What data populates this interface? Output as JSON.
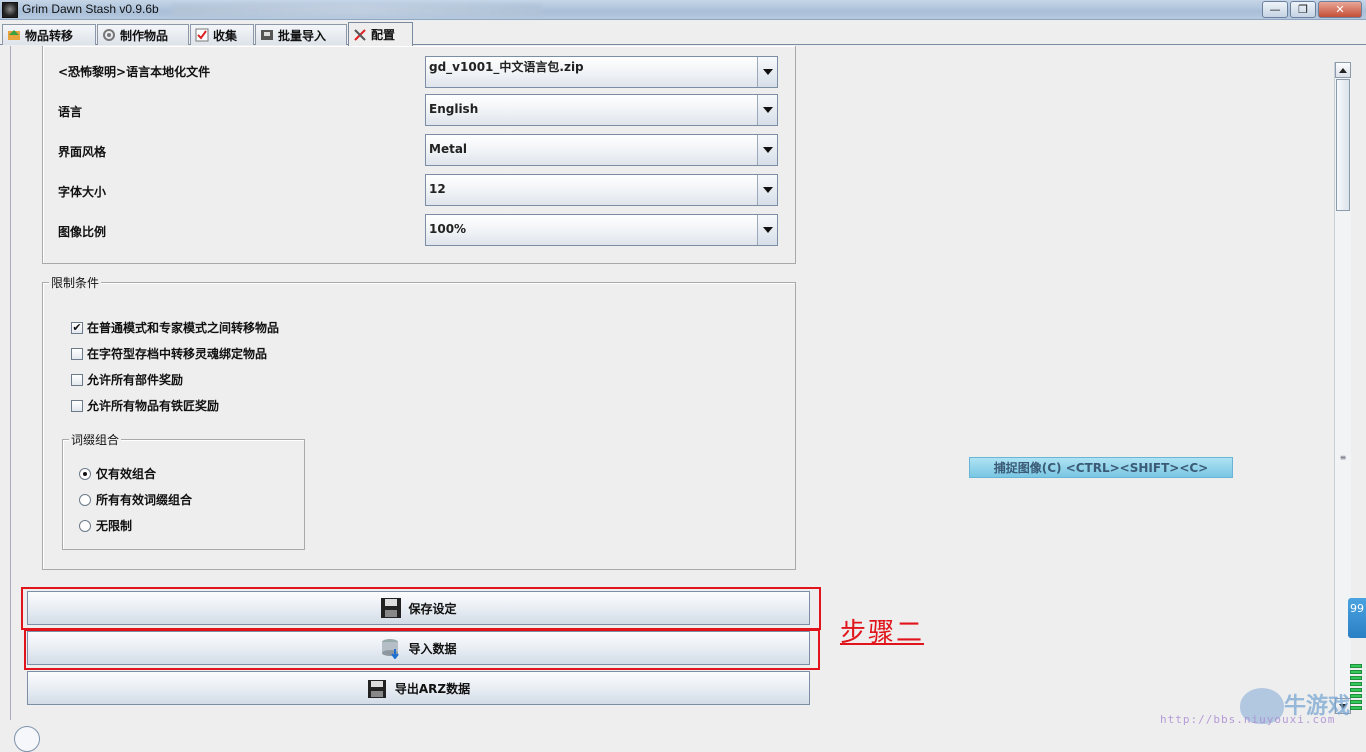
{
  "window": {
    "title": "Grim Dawn Stash v0.9.6b",
    "min_glyph": "—",
    "max_glyph": "❐",
    "close_glyph": "✕"
  },
  "tabs": [
    {
      "label": "物品转移",
      "icon": "transfer-icon",
      "active": false
    },
    {
      "label": "制作物品",
      "icon": "gear-icon",
      "active": false
    },
    {
      "label": "收集",
      "icon": "checklist-icon",
      "active": false
    },
    {
      "label": "批量导入",
      "icon": "import-icon",
      "active": false
    },
    {
      "label": "配置",
      "icon": "tools-icon",
      "active": true
    }
  ],
  "settings": {
    "rows": [
      {
        "label": "<恐怖黎明>语言本地化文件",
        "value": "gd_v1001_中文语言包.zip"
      },
      {
        "label": "语言",
        "value": "English"
      },
      {
        "label": "界面风格",
        "value": "Metal"
      },
      {
        "label": "字体大小",
        "value": "12"
      },
      {
        "label": "图像比例",
        "value": "100%"
      }
    ]
  },
  "restrictions": {
    "title": "限制条件",
    "checkboxes": [
      {
        "label": "在普通模式和专家模式之间转移物品",
        "checked": true
      },
      {
        "label": "在字符型存档中转移灵魂绑定物品",
        "checked": false
      },
      {
        "label": "允许所有部件奖励",
        "checked": false
      },
      {
        "label": "允许所有物品有铁匠奖励",
        "checked": false
      }
    ],
    "affix": {
      "title": "词缀组合",
      "options": [
        {
          "label": "仅有效组合",
          "selected": true
        },
        {
          "label": "所有有效词缀组合",
          "selected": false
        },
        {
          "label": "无限制",
          "selected": false
        }
      ]
    }
  },
  "actions": {
    "save": "保存设定",
    "import": "导入数据",
    "export": "导出ARZ数据"
  },
  "annotation": {
    "step": "步骤二"
  },
  "capture": {
    "label": "捕捉图像(C)    <CTRL><SHIFT><C>"
  },
  "side_tab": {
    "label": "99"
  },
  "watermark": {
    "text": "牛游戏",
    "url": "http://bbs.niuyouxi.com"
  },
  "colors": {
    "highlight": "#e0141a",
    "capture_bg": "#79c6e3"
  }
}
